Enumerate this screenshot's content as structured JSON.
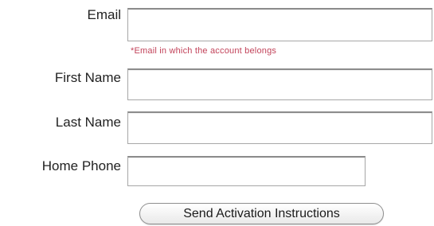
{
  "form": {
    "email": {
      "label": "Email",
      "value": "",
      "hint": "*Email in which the account belongs"
    },
    "first_name": {
      "label": "First Name",
      "value": ""
    },
    "last_name": {
      "label": "Last Name",
      "value": ""
    },
    "home_phone": {
      "label": "Home Phone",
      "value": ""
    },
    "submit_label": "Send Activation Instructions"
  },
  "colors": {
    "hint_text": "#c2435a",
    "field_border": "#a7a7a7"
  }
}
